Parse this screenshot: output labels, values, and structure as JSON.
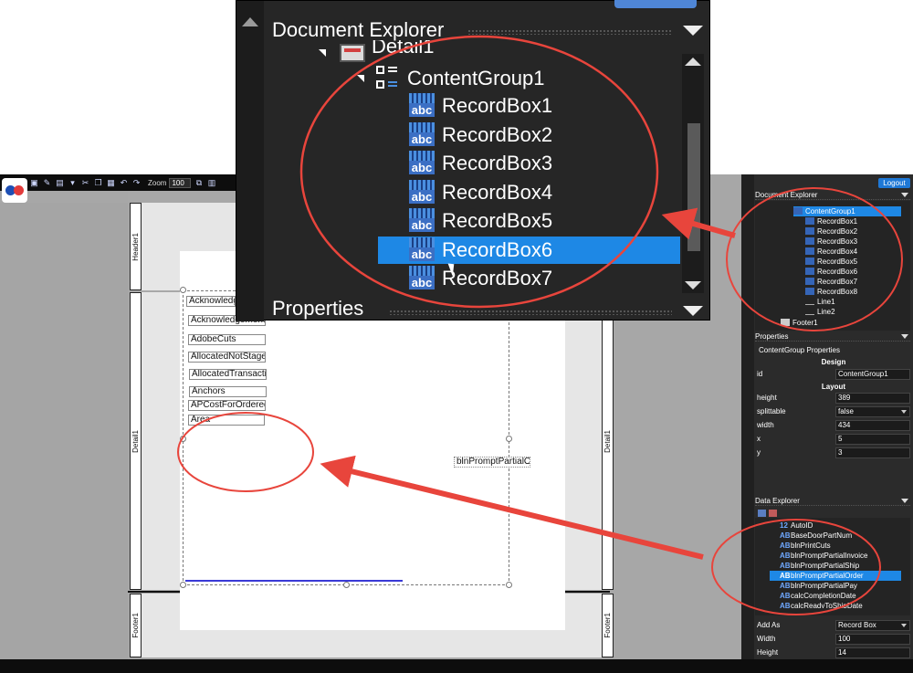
{
  "toolbar": {
    "zoom_label": "Zoom",
    "zoom_value": "100"
  },
  "logout_label": "Logout",
  "bands": {
    "header": "Header1",
    "detail_left": "Detail1",
    "detail_right": "Detail1",
    "footer_left": "Footer1",
    "footer_right": "Footer1"
  },
  "design_fields": [
    "Acknowledg",
    "Acknowledgement",
    "AdobeCuts",
    "AllocatedNotStage",
    "AllocatedTransacti",
    "Anchors",
    "APCostForOrdered",
    "Area"
  ],
  "dropped_field": "blnPromptPartialOr",
  "document_explorer": {
    "title": "Document Explorer",
    "detail_label": "Detail1",
    "group": "ContentGroup1",
    "items": [
      "RecordBox1",
      "RecordBox2",
      "RecordBox3",
      "RecordBox4",
      "RecordBox5",
      "RecordBox6",
      "RecordBox7",
      "RecordBox8"
    ],
    "lines": [
      "Line1",
      "Line2"
    ],
    "footer": "Footer1",
    "selected_zoom": "RecordBox6",
    "selected_small": "ContentGroup1"
  },
  "properties": {
    "title": "Properties",
    "subtitle": "ContentGroup Properties",
    "design_section": "Design",
    "id_label": "id",
    "id_value": "ContentGroup1",
    "layout_section": "Layout",
    "rows": [
      {
        "label": "height",
        "value": "389"
      },
      {
        "label": "splittable",
        "value": "false"
      },
      {
        "label": "width",
        "value": "434"
      },
      {
        "label": "x",
        "value": "5"
      },
      {
        "label": "y",
        "value": "3"
      }
    ]
  },
  "data_explorer": {
    "title": "Data Explorer",
    "items": [
      {
        "type": "12",
        "name": "AutoID"
      },
      {
        "type": "AB",
        "name": "BaseDoorPartNum"
      },
      {
        "type": "AB",
        "name": "blnPrintCuts"
      },
      {
        "type": "AB",
        "name": "blnPromptPartialInvoice"
      },
      {
        "type": "AB",
        "name": "blnPromptPartialShip"
      },
      {
        "type": "AB",
        "name": "blnPromptPartialOrder"
      },
      {
        "type": "AB",
        "name": "blnPromptPartialPay"
      },
      {
        "type": "AB",
        "name": "calcCompletionDate"
      },
      {
        "type": "AB",
        "name": "calcReadyToShipDate"
      }
    ],
    "selected": "blnPromptPartialOrder"
  },
  "add_options": {
    "add_as_label": "Add As",
    "add_as_value": "Record Box",
    "width_label": "Width",
    "width_value": "100",
    "height_label": "Height",
    "height_value": "14"
  },
  "colors": {
    "selection": "#1e88e5",
    "annotation": "#e8453c",
    "panel": "#2b2b2b"
  }
}
